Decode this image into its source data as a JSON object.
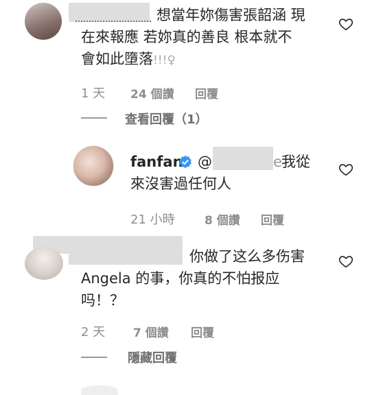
{
  "comments": [
    {
      "text_line1": "想當年妳傷害張韶涵 現",
      "text_line2": "在來報應 若妳真的善良 根本就不",
      "text_line3": "會如此墮落",
      "text_suffix": "!!!♀",
      "time": "1 天",
      "likes": "24 個讚",
      "reply": "回覆",
      "view_replies": "查看回覆（1）"
    },
    {
      "username": "fanfan",
      "mention": "@",
      "mention_tail": "e",
      "text_line1": "我從",
      "text_line2": "來沒害過任何人",
      "time": "21 小時",
      "likes": "8 個讚",
      "reply": "回覆"
    },
    {
      "text_line1": "你做了这么多伤害",
      "text_line2": "Angela 的事，你真的不怕报应",
      "text_line3": "吗！？",
      "time": "2 天",
      "likes": "7 個讚",
      "reply": "回覆",
      "hide_replies": "隱藏回覆"
    }
  ],
  "colors": {
    "text": "#262626",
    "meta": "#8e8e8e",
    "verified": "#3897f0"
  }
}
